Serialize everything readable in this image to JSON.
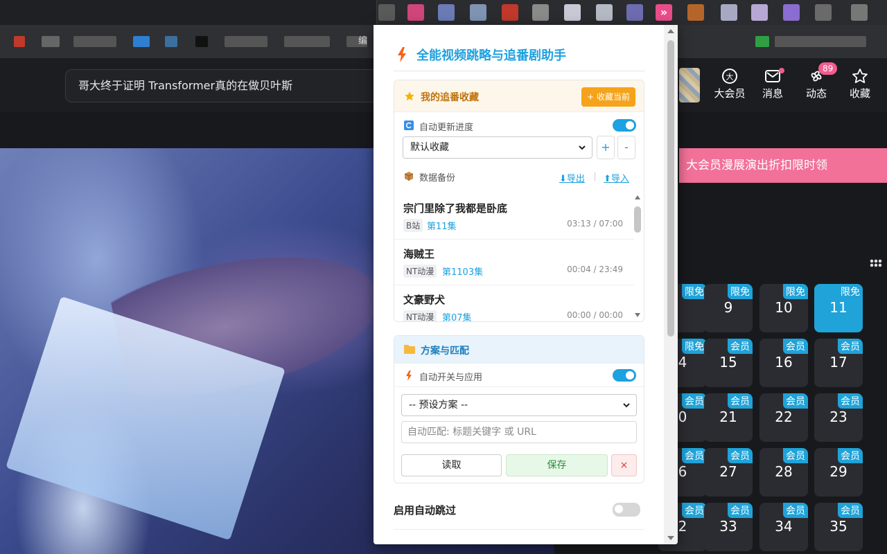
{
  "browser": {
    "active_tab_visible_char": "编"
  },
  "page": {
    "search_value": "哥大终于证明 Transformer真的在做贝叶斯",
    "header_items": [
      {
        "label": "大会员",
        "icon": "vip-icon"
      },
      {
        "label": "消息",
        "icon": "message-icon"
      },
      {
        "label": "动态",
        "icon": "dynamic-icon",
        "badge": "89"
      },
      {
        "label": "收藏",
        "icon": "star-icon"
      }
    ],
    "promo_text": "大会员漫展演出折扣限时领",
    "days": [
      {
        "num": "",
        "tag": "限免"
      },
      {
        "num": "9",
        "tag": "限免"
      },
      {
        "num": "10",
        "tag": "限免"
      },
      {
        "num": "11",
        "tag": "限免",
        "active": true
      },
      {
        "num": "4",
        "tag": "限免"
      },
      {
        "num": "15",
        "tag": "会员"
      },
      {
        "num": "16",
        "tag": "会员"
      },
      {
        "num": "17",
        "tag": "会员"
      },
      {
        "num": "0",
        "tag": "会员"
      },
      {
        "num": "21",
        "tag": "会员"
      },
      {
        "num": "22",
        "tag": "会员"
      },
      {
        "num": "23",
        "tag": "会员"
      },
      {
        "num": "6",
        "tag": "会员"
      },
      {
        "num": "27",
        "tag": "会员"
      },
      {
        "num": "28",
        "tag": "会员"
      },
      {
        "num": "29",
        "tag": "会员"
      },
      {
        "num": "2",
        "tag": "会员"
      },
      {
        "num": "33",
        "tag": "会员"
      },
      {
        "num": "34",
        "tag": "会员"
      },
      {
        "num": "35",
        "tag": "会员"
      }
    ]
  },
  "popup": {
    "title": "全能视频跳略与追番剧助手",
    "collection": {
      "title": "我的追番收藏",
      "add_button": "+ 收藏当前",
      "auto_update_label": "自动更新进度",
      "auto_update_on": true,
      "folder_selected": "默认收藏",
      "plus_label": "+",
      "minus_label": "-",
      "backup_label": "数据备份",
      "export_label": "⬇导出",
      "import_label": "⬆导入",
      "items": [
        {
          "title": "宗门里除了我都是卧底",
          "source": "B站",
          "episode": "第11集",
          "time": "03:13 / 07:00"
        },
        {
          "title": "海贼王",
          "source": "NT动漫",
          "episode": "第1103集",
          "time": "00:04 / 23:49"
        },
        {
          "title": "文豪野犬",
          "source": "NT动漫",
          "episode": "第07集",
          "time": "00:00 / 00:00"
        }
      ]
    },
    "scheme": {
      "title": "方案与匹配",
      "auto_switch_label": "自动开关与应用",
      "auto_switch_on": true,
      "preset_selected": "-- 预设方案 --",
      "match_placeholder": "自动匹配: 标题关键字 或 URL",
      "read_label": "读取",
      "save_label": "保存",
      "delete_label": "×"
    },
    "auto_skip": {
      "label": "启用自动跳过",
      "on": false
    }
  },
  "colors": {
    "accent": "#1da1e0",
    "orange": "#f5a31a",
    "pink": "#f27198"
  }
}
